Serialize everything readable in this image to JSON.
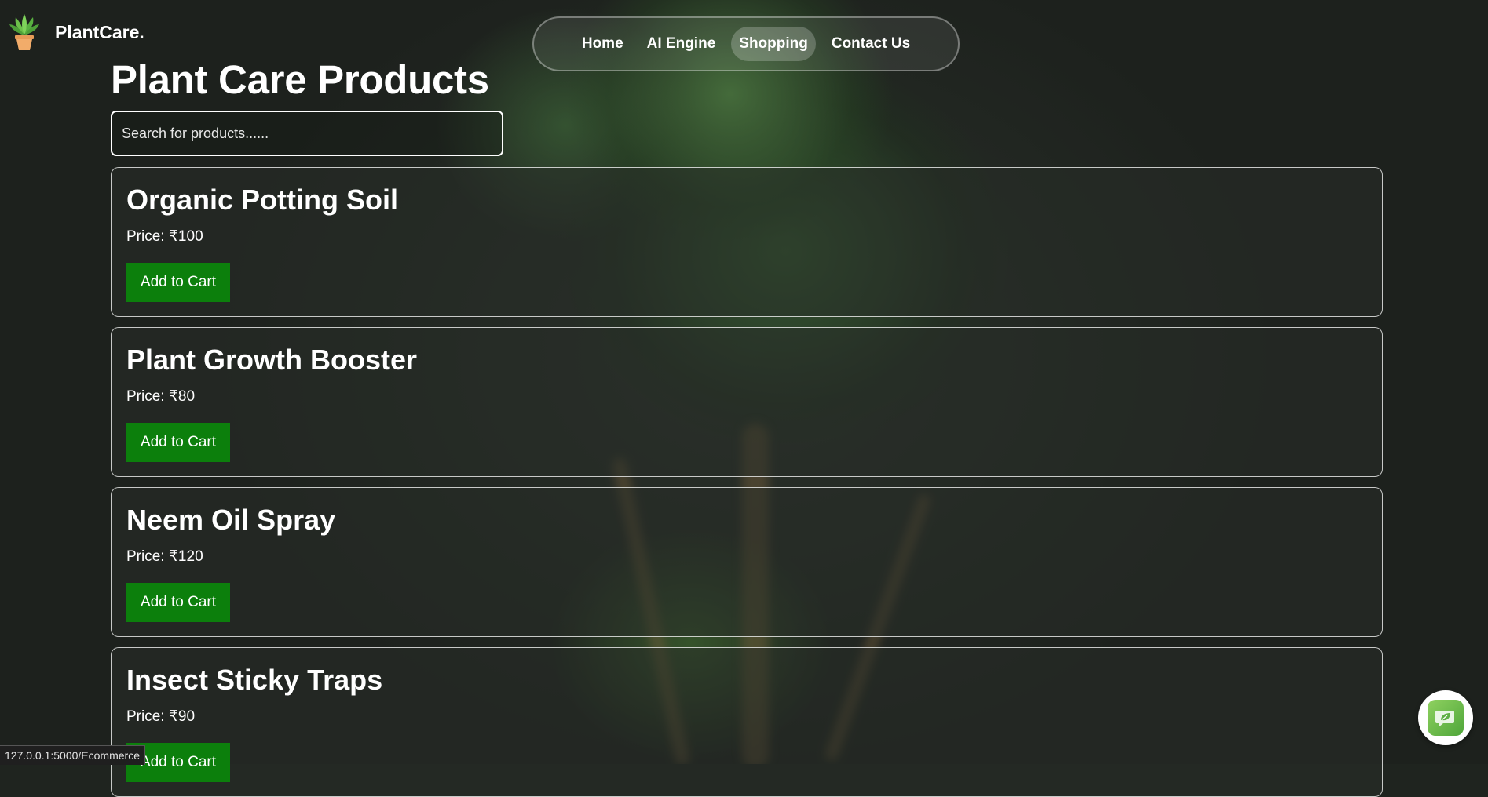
{
  "header": {
    "brand": "PlantCare.",
    "logo_icon": "potted-plant-icon"
  },
  "nav": {
    "items": [
      {
        "label": "Home",
        "active": false
      },
      {
        "label": "AI Engine",
        "active": false
      },
      {
        "label": "Shopping",
        "active": true
      },
      {
        "label": "Contact Us",
        "active": false
      }
    ]
  },
  "main": {
    "title": "Plant Care Products",
    "search": {
      "placeholder": "Search for products......",
      "value": ""
    },
    "products": [
      {
        "name": "Organic Potting Soil",
        "price": "Price: ₹100",
        "button": "Add to Cart"
      },
      {
        "name": "Plant Growth Booster",
        "price": "Price: ₹80",
        "button": "Add to Cart"
      },
      {
        "name": "Neem Oil Spray",
        "price": "Price: ₹120",
        "button": "Add to Cart"
      },
      {
        "name": "Insect Sticky Traps",
        "price": "Price: ₹90",
        "button": "Add to Cart"
      }
    ]
  },
  "status_bar": {
    "url": "127.0.0.1:5000/Ecommerce"
  },
  "chat": {
    "icon": "leaf-chat-icon"
  },
  "colors": {
    "accent_button": "#0c7f0c",
    "chat_bg": "#6dbf4b"
  }
}
